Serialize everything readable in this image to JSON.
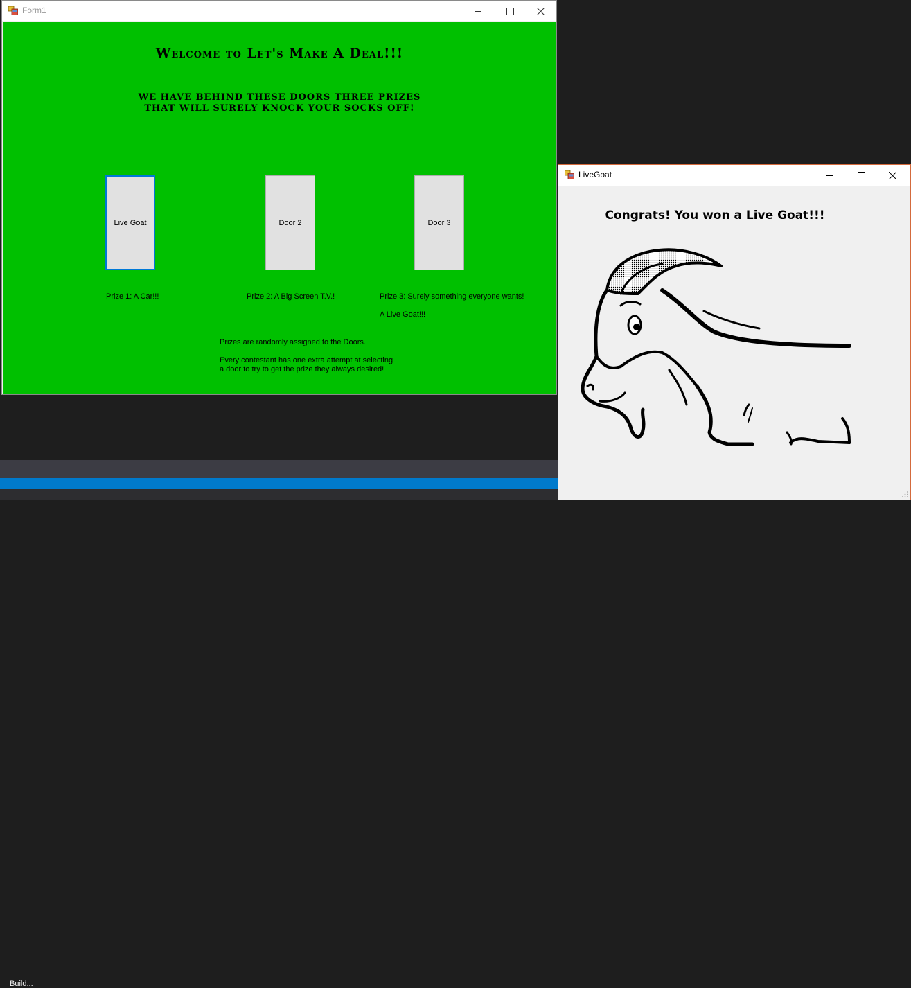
{
  "form1": {
    "title": "Form1",
    "heading": "Welcome to Let's Make A Deal!!!",
    "subheading_line1": "We have behind these doors three prizes",
    "subheading_line2": "that will surely knock your socks off!",
    "doors": [
      {
        "label": "Live Goat"
      },
      {
        "label": "Door 2"
      },
      {
        "label": "Door 3"
      }
    ],
    "prizes": {
      "prize1": "Prize 1: A Car!!!",
      "prize2": "Prize 2: A Big Screen T.V.!",
      "prize3": "Prize 3: Surely something everyone wants!",
      "prize3_detail": "A Live Goat!!!"
    },
    "info_line1": "Prizes are randomly assigned to the Doors.",
    "info_line2": "Every contestant has one extra attempt at selecting",
    "info_line3": "a door to try to get the prize they always desired!",
    "background_color": "#00c000"
  },
  "livegoat": {
    "title": "LiveGoat",
    "message": "Congrats! You won a Live Goat!!!"
  },
  "ide": {
    "status": "Build..."
  }
}
